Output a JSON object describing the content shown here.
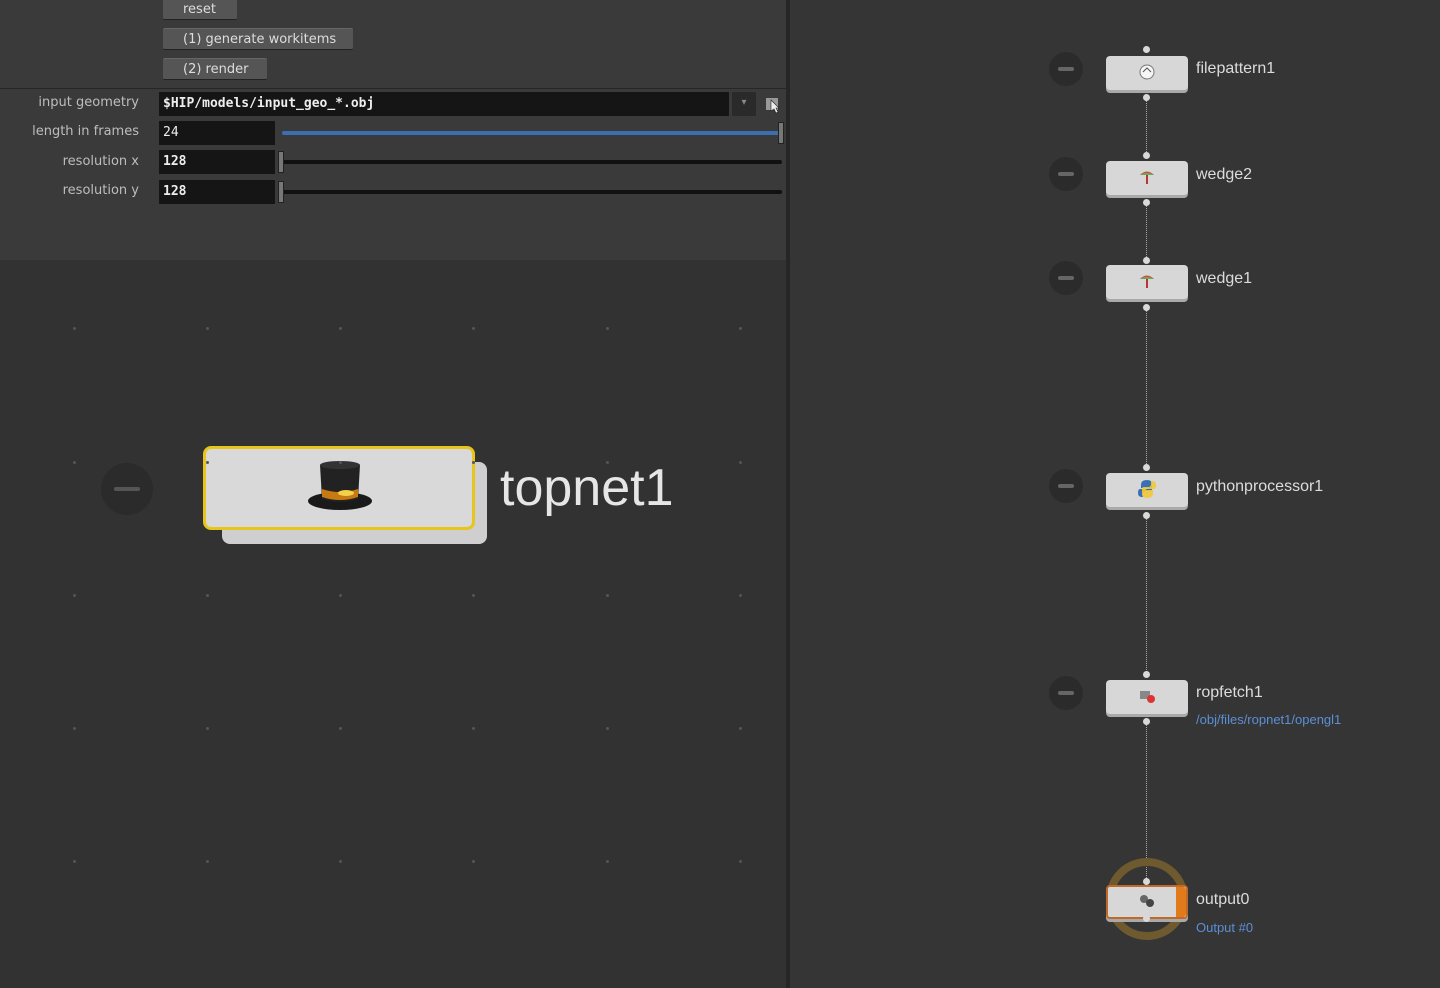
{
  "params": {
    "buttons": {
      "reset": "reset",
      "generate": "(1) generate workitems",
      "render": "(2) render"
    },
    "input_geometry": {
      "label": "input geometry",
      "value": "$HIP/models/input_geo_*.obj"
    },
    "length_in_frames": {
      "label": "length in frames",
      "value": "24",
      "slider_fraction": 1.0
    },
    "resolution_x": {
      "label": "resolution x",
      "value": "128",
      "slider_fraction": 0.0
    },
    "resolution_y": {
      "label": "resolution y",
      "value": "128",
      "slider_fraction": 0.0
    }
  },
  "left_network": {
    "node": {
      "name": "topnet1",
      "icon": "top-hat-icon"
    }
  },
  "right_network": {
    "nodes": [
      {
        "name": "filepattern1",
        "icon": "filepattern-icon"
      },
      {
        "name": "wedge2",
        "icon": "wedge-icon"
      },
      {
        "name": "wedge1",
        "icon": "wedge-icon"
      },
      {
        "name": "pythonprocessor1",
        "icon": "python-icon"
      },
      {
        "name": "ropfetch1",
        "icon": "ropfetch-icon",
        "sub": "/obj/files/ropnet1/opengl1"
      },
      {
        "name": "output0",
        "icon": "output-icon",
        "sub": "Output #0"
      }
    ]
  },
  "colors": {
    "selected_outline": "#e8c51a",
    "output_flag": "#e07a1a",
    "path_link": "#5b8fd6",
    "slider_blue": "#3b6fb0"
  }
}
